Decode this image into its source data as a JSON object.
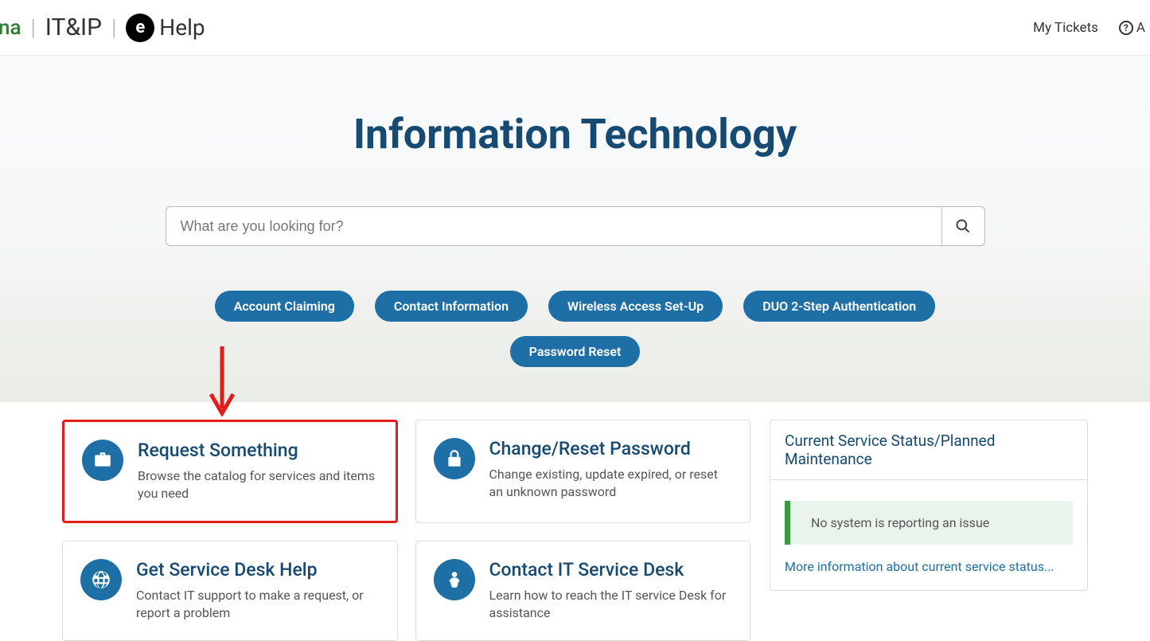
{
  "header": {
    "logo_suffix": "na",
    "dept": "IT&IP",
    "ehelp_badge": "e",
    "ehelp_text": "Help",
    "my_tickets": "My Tickets",
    "help_partial": "A"
  },
  "hero": {
    "title": "Information Technology",
    "search_placeholder": "What are you looking for?",
    "pills": [
      "Account Claiming",
      "Contact Information",
      "Wireless Access Set-Up",
      "DUO 2-Step Authentication",
      "Password Reset"
    ]
  },
  "cards": [
    {
      "title": "Request Something",
      "desc": "Browse the catalog for services and items you need",
      "icon": "briefcase",
      "highlight": true
    },
    {
      "title": "Change/Reset Password",
      "desc": "Change existing, update expired, or reset an unknown password",
      "icon": "lock",
      "highlight": false
    },
    {
      "title": "Get Service Desk Help",
      "desc": "Contact IT support to make a request, or report a problem",
      "icon": "globe",
      "highlight": false
    },
    {
      "title": "Contact IT Service Desk",
      "desc": "Learn how to reach the IT service Desk for assistance",
      "icon": "person",
      "highlight": false
    }
  ],
  "side": {
    "panel_title": "Current Service Status/Planned Maintenance",
    "status_text": "No system is reporting an issue",
    "more_link": "More information about current service status..."
  }
}
